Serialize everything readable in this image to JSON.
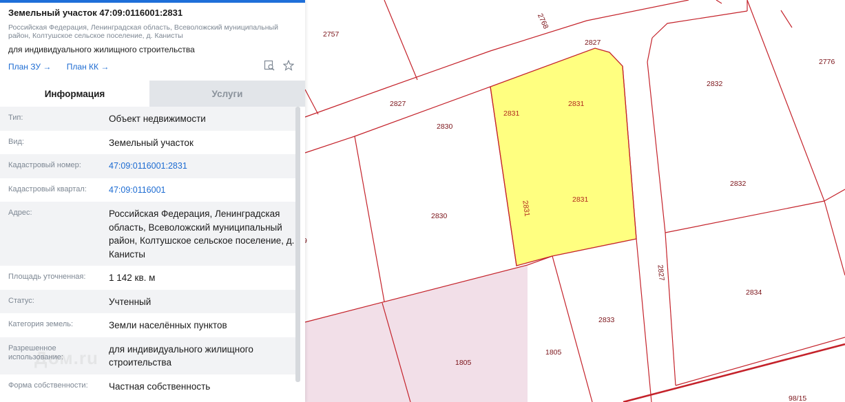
{
  "panel": {
    "title": "Земельный участок 47:09:0116001:2831",
    "address_short": "Российская Федерация, Ленинградская область, Всеволожский муниципальный район, Колтушское сельское поселение, д. Канисты",
    "purpose": "для индивидуального жилищного строительства",
    "links": {
      "plan_zu": "План ЗУ →",
      "plan_kk": "План КК →"
    },
    "icons": [
      "search-document-icon",
      "star-icon"
    ],
    "tabs": [
      {
        "label": "Информация",
        "active": true
      },
      {
        "label": "Услуги",
        "active": false
      }
    ],
    "rows": [
      {
        "key": "Тип:",
        "value": "Объект недвижимости"
      },
      {
        "key": "Вид:",
        "value": "Земельный участок"
      },
      {
        "key": "Кадастровый номер:",
        "value": "47:09:0116001:2831",
        "link": true
      },
      {
        "key": "Кадастровый квартал:",
        "value": "47:09:0116001",
        "link": true
      },
      {
        "key": "Адрес:",
        "value": "Российская Федерация, Ленинградская область, Всеволожский муниципальный район, Колтушское сельское поселение, д. Канисты"
      },
      {
        "key": "Площадь уточненная:",
        "value": "1 142 кв. м"
      },
      {
        "key": "Статус:",
        "value": "Учтенный"
      },
      {
        "key": "Категория земель:",
        "value": "Земли населённых пунктов"
      },
      {
        "key": "Разрешенное использование:",
        "value": "для индивидуального жилищного строительства"
      },
      {
        "key": "Форма собственности:",
        "value": "Частная собственность"
      }
    ],
    "watermark": "Дом.ru"
  },
  "map": {
    "colors": {
      "boundary": "#c4222a",
      "selected_fill": "#ffff80",
      "pink_fill": "#f2dfe8",
      "label": "#7a1218"
    },
    "labels": [
      "2757",
      "2768",
      "2827",
      "2776",
      "2832",
      "2831",
      "2830",
      "2832",
      "2831",
      "2831",
      "2830",
      "2831",
      "2827",
      "2834",
      "2833",
      "1805",
      "1805",
      "98/15",
      "9",
      "2827"
    ]
  }
}
